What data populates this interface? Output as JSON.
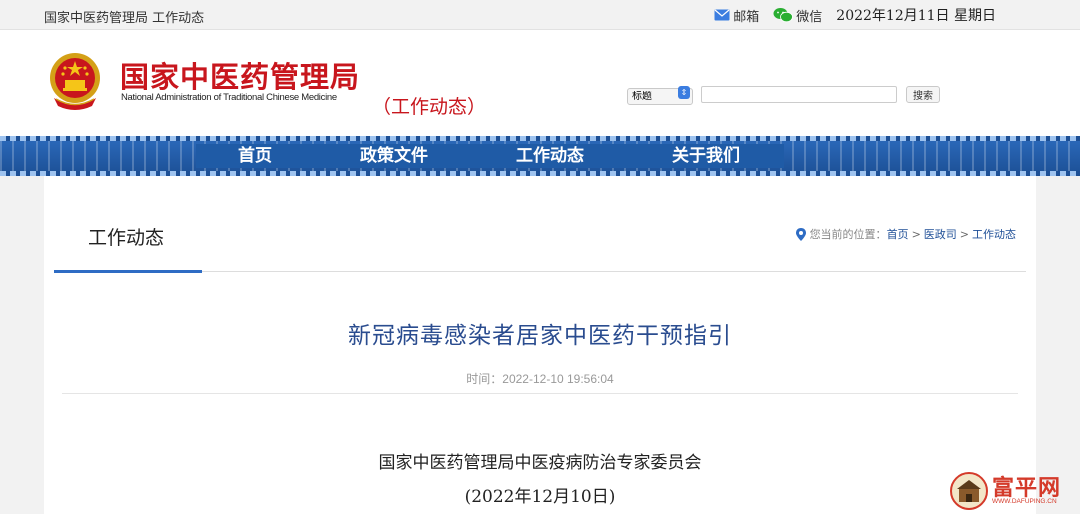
{
  "topbar": {
    "breadcrumb": "国家中医药管理局 工作动态",
    "mail_label": "邮箱",
    "wechat_label": "微信",
    "date": "2022年12月11日 星期日"
  },
  "header": {
    "logo_cn": "国家中医药管理局",
    "logo_en": "National Administration of Traditional Chinese Medicine",
    "section_tag": "（工作动态）",
    "search": {
      "select_value": "标题",
      "input_value": "",
      "button_label": "搜索"
    }
  },
  "nav": {
    "items": [
      {
        "label": "首页"
      },
      {
        "label": "政策文件"
      },
      {
        "label": "工作动态"
      },
      {
        "label": "关于我们"
      }
    ]
  },
  "content": {
    "page_title": "工作动态",
    "location": {
      "prefix": "您当前的位置：",
      "crumbs": [
        "首页",
        "医政司",
        "工作动态"
      ],
      "separator": ">"
    },
    "article": {
      "title": "新冠病毒感染者居家中医药干预指引",
      "time": "时间：2022-12-10 19:56:04",
      "author": "国家中医药管理局中医疫病防治专家委员会",
      "date": "(2022年12月10日)"
    }
  },
  "watermark": {
    "name": "富平网",
    "url": "WWW.DAFUPING.CN"
  },
  "colors": {
    "brand_red": "#c8161d",
    "nav_blue": "#1f5ba6",
    "title_blue": "#2a4c8f"
  }
}
